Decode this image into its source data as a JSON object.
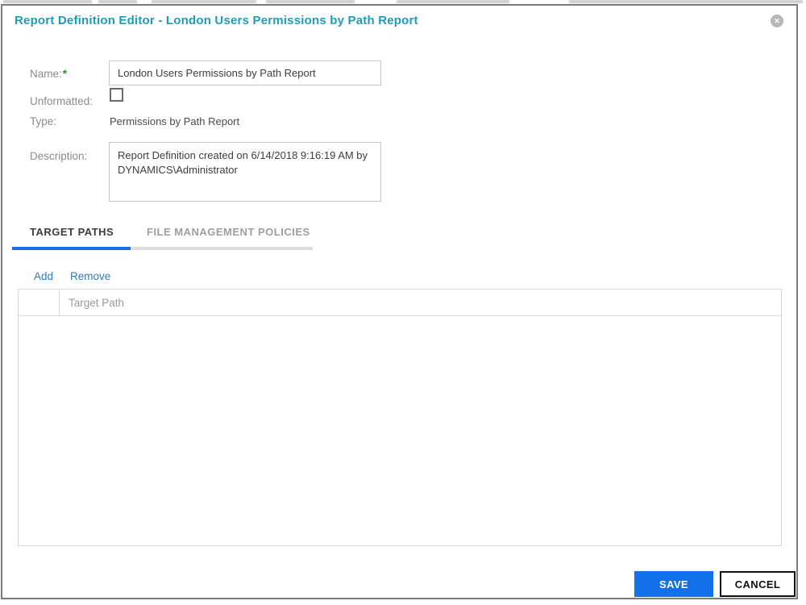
{
  "dialog": {
    "title": "Report Definition Editor - London Users Permissions by Path Report",
    "close_glyph": "✕",
    "form": {
      "name_label": "Name:",
      "required_marker": "*",
      "name_value": "London Users Permissions by Path Report",
      "unformatted_label": "Unformatted:",
      "unformatted_checked": false,
      "type_label": "Type:",
      "type_value": "Permissions by Path Report",
      "description_label": "Description:",
      "description_value": "Report Definition created on 6/14/2018 9:16:19 AM by\nDYNAMICS\\Administrator"
    },
    "tabs": [
      {
        "label": "TARGET PATHS",
        "active": true
      },
      {
        "label": "FILE MANAGEMENT POLICIES",
        "active": false
      }
    ],
    "actions": {
      "add_label": "Add",
      "remove_label": "Remove"
    },
    "table": {
      "path_column_header": "Target Path",
      "rows": []
    },
    "footer": {
      "save_label": "SAVE",
      "cancel_label": "CANCEL"
    },
    "colors": {
      "title_teal": "#1f9bb8",
      "accent_blue": "#1271e8",
      "link_blue": "#2b7cc0"
    }
  }
}
